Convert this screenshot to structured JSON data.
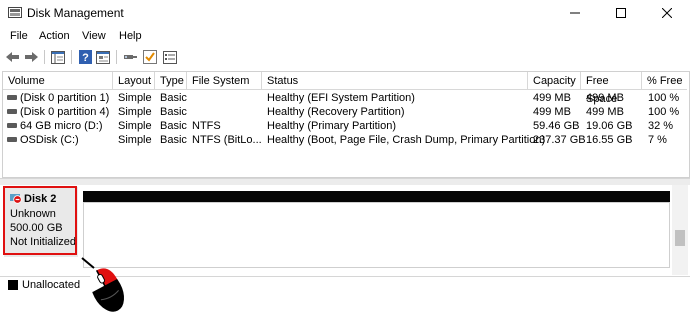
{
  "window": {
    "title": "Disk Management",
    "icon": "disk-management-icon",
    "controls": [
      "minimize-icon",
      "maximize-icon",
      "close-icon"
    ]
  },
  "menu": [
    "File",
    "Action",
    "View",
    "Help"
  ],
  "toolbar": [
    "back-arrow-icon",
    "forward-arrow-icon",
    "console-tree-icon",
    "help-icon",
    "disk-properties-icon",
    "rescan-check-icon",
    "settings-list-icon"
  ],
  "volume_table": {
    "headers": [
      "Volume",
      "Layout",
      "Type",
      "File System",
      "Status",
      "Capacity",
      "Free Space",
      "% Free"
    ],
    "rows": [
      [
        "(Disk 0 partition 1)",
        "Simple",
        "Basic",
        "",
        "Healthy (EFI System Partition)",
        "499 MB",
        "499 MB",
        "100 %"
      ],
      [
        "(Disk 0 partition 4)",
        "Simple",
        "Basic",
        "",
        "Healthy (Recovery Partition)",
        "499 MB",
        "499 MB",
        "100 %"
      ],
      [
        "64 GB micro (D:)",
        "Simple",
        "Basic",
        "NTFS",
        "Healthy (Primary Partition)",
        "59.46 GB",
        "19.06 GB",
        "32 %"
      ],
      [
        "OSDisk (C:)",
        "Simple",
        "Basic",
        "NTFS (BitLo...",
        "Healthy (Boot, Page File, Crash Dump, Primary Partition)",
        "237.37 GB",
        "16.55 GB",
        "7 %"
      ]
    ]
  },
  "disk": {
    "name": "Disk 2",
    "type": "Unknown",
    "size": "500.00 GB",
    "state": "Not Initialized",
    "highlight_color": "#e01010"
  },
  "legend": {
    "label": "Unallocated",
    "color": "#000000"
  }
}
